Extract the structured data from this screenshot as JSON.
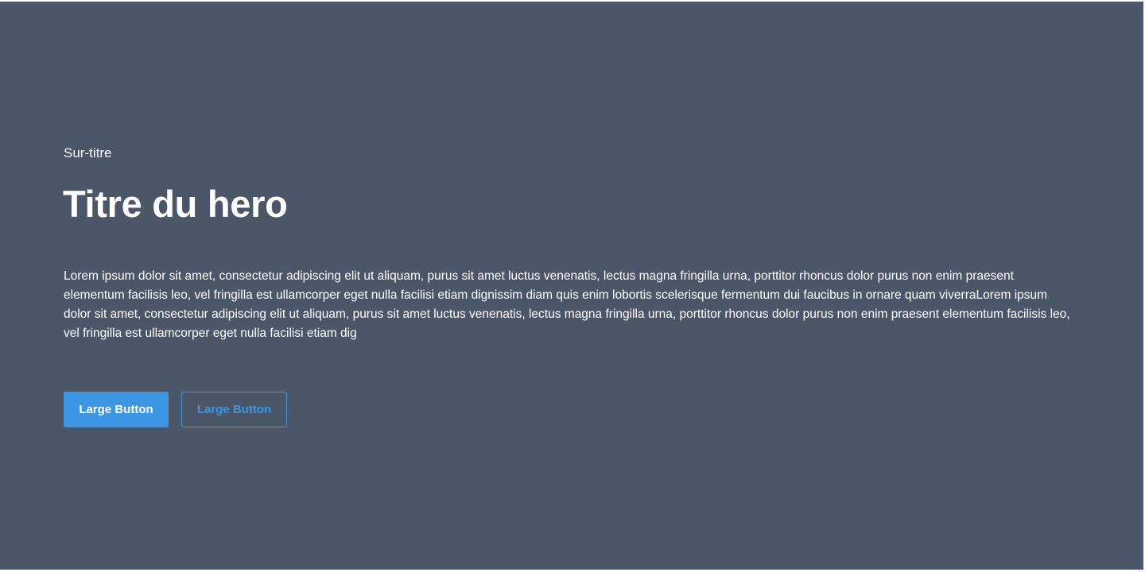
{
  "colors": {
    "background": "#4b5669",
    "text": "#ffffff",
    "accent": "#3b95e2"
  },
  "hero": {
    "surtitle": "Sur-titre",
    "title": "Titre du hero",
    "body": "Lorem ipsum dolor sit amet, consectetur adipiscing elit ut aliquam, purus sit amet luctus venenatis, lectus magna fringilla urna, porttitor rhoncus dolor purus non enim praesent elementum facilisis leo, vel fringilla est ullamcorper eget nulla facilisi etiam dignissim diam quis enim lobortis scelerisque fermentum dui faucibus in ornare quam viverraLorem ipsum dolor sit amet, consectetur adipiscing elit ut aliquam, purus sit amet luctus venenatis, lectus magna fringilla urna, porttitor rhoncus dolor purus non enim praesent elementum facilisis leo, vel fringilla est ullamcorper eget nulla facilisi etiam dig",
    "primary_button_label": "Large Button",
    "secondary_button_label": "Large Button"
  }
}
